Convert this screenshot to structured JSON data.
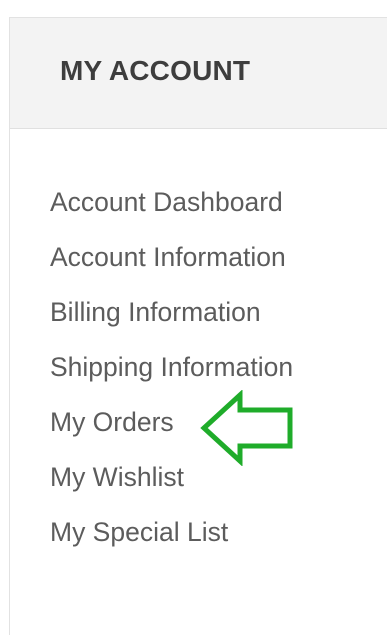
{
  "account_nav": {
    "title": "MY ACCOUNT",
    "items": [
      {
        "label": "Account Dashboard"
      },
      {
        "label": "Account Information"
      },
      {
        "label": "Billing Information"
      },
      {
        "label": "Shipping Information"
      },
      {
        "label": "My Orders"
      },
      {
        "label": "My Wishlist"
      },
      {
        "label": "My Special List"
      }
    ]
  },
  "annotation": {
    "icon": "arrow-left-outline-icon",
    "color": "#1fac2a",
    "points_to_item": "My Orders"
  }
}
